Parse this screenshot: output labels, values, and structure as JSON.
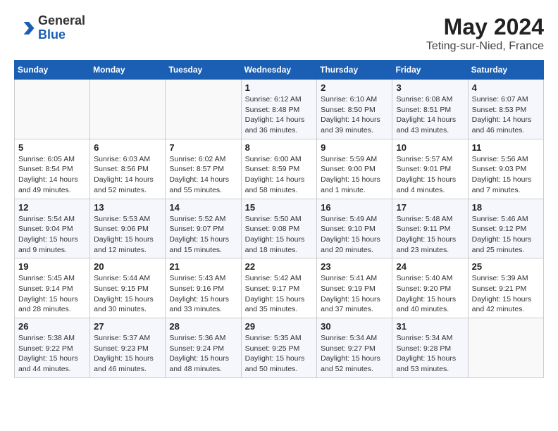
{
  "header": {
    "logo_general": "General",
    "logo_blue": "Blue",
    "month": "May 2024",
    "location": "Teting-sur-Nied, France"
  },
  "days_of_week": [
    "Sunday",
    "Monday",
    "Tuesday",
    "Wednesday",
    "Thursday",
    "Friday",
    "Saturday"
  ],
  "weeks": [
    [
      {
        "day": "",
        "info": ""
      },
      {
        "day": "",
        "info": ""
      },
      {
        "day": "",
        "info": ""
      },
      {
        "day": "1",
        "info": "Sunrise: 6:12 AM\nSunset: 8:48 PM\nDaylight: 14 hours and 36 minutes."
      },
      {
        "day": "2",
        "info": "Sunrise: 6:10 AM\nSunset: 8:50 PM\nDaylight: 14 hours and 39 minutes."
      },
      {
        "day": "3",
        "info": "Sunrise: 6:08 AM\nSunset: 8:51 PM\nDaylight: 14 hours and 43 minutes."
      },
      {
        "day": "4",
        "info": "Sunrise: 6:07 AM\nSunset: 8:53 PM\nDaylight: 14 hours and 46 minutes."
      }
    ],
    [
      {
        "day": "5",
        "info": "Sunrise: 6:05 AM\nSunset: 8:54 PM\nDaylight: 14 hours and 49 minutes."
      },
      {
        "day": "6",
        "info": "Sunrise: 6:03 AM\nSunset: 8:56 PM\nDaylight: 14 hours and 52 minutes."
      },
      {
        "day": "7",
        "info": "Sunrise: 6:02 AM\nSunset: 8:57 PM\nDaylight: 14 hours and 55 minutes."
      },
      {
        "day": "8",
        "info": "Sunrise: 6:00 AM\nSunset: 8:59 PM\nDaylight: 14 hours and 58 minutes."
      },
      {
        "day": "9",
        "info": "Sunrise: 5:59 AM\nSunset: 9:00 PM\nDaylight: 15 hours and 1 minute."
      },
      {
        "day": "10",
        "info": "Sunrise: 5:57 AM\nSunset: 9:01 PM\nDaylight: 15 hours and 4 minutes."
      },
      {
        "day": "11",
        "info": "Sunrise: 5:56 AM\nSunset: 9:03 PM\nDaylight: 15 hours and 7 minutes."
      }
    ],
    [
      {
        "day": "12",
        "info": "Sunrise: 5:54 AM\nSunset: 9:04 PM\nDaylight: 15 hours and 9 minutes."
      },
      {
        "day": "13",
        "info": "Sunrise: 5:53 AM\nSunset: 9:06 PM\nDaylight: 15 hours and 12 minutes."
      },
      {
        "day": "14",
        "info": "Sunrise: 5:52 AM\nSunset: 9:07 PM\nDaylight: 15 hours and 15 minutes."
      },
      {
        "day": "15",
        "info": "Sunrise: 5:50 AM\nSunset: 9:08 PM\nDaylight: 15 hours and 18 minutes."
      },
      {
        "day": "16",
        "info": "Sunrise: 5:49 AM\nSunset: 9:10 PM\nDaylight: 15 hours and 20 minutes."
      },
      {
        "day": "17",
        "info": "Sunrise: 5:48 AM\nSunset: 9:11 PM\nDaylight: 15 hours and 23 minutes."
      },
      {
        "day": "18",
        "info": "Sunrise: 5:46 AM\nSunset: 9:12 PM\nDaylight: 15 hours and 25 minutes."
      }
    ],
    [
      {
        "day": "19",
        "info": "Sunrise: 5:45 AM\nSunset: 9:14 PM\nDaylight: 15 hours and 28 minutes."
      },
      {
        "day": "20",
        "info": "Sunrise: 5:44 AM\nSunset: 9:15 PM\nDaylight: 15 hours and 30 minutes."
      },
      {
        "day": "21",
        "info": "Sunrise: 5:43 AM\nSunset: 9:16 PM\nDaylight: 15 hours and 33 minutes."
      },
      {
        "day": "22",
        "info": "Sunrise: 5:42 AM\nSunset: 9:17 PM\nDaylight: 15 hours and 35 minutes."
      },
      {
        "day": "23",
        "info": "Sunrise: 5:41 AM\nSunset: 9:19 PM\nDaylight: 15 hours and 37 minutes."
      },
      {
        "day": "24",
        "info": "Sunrise: 5:40 AM\nSunset: 9:20 PM\nDaylight: 15 hours and 40 minutes."
      },
      {
        "day": "25",
        "info": "Sunrise: 5:39 AM\nSunset: 9:21 PM\nDaylight: 15 hours and 42 minutes."
      }
    ],
    [
      {
        "day": "26",
        "info": "Sunrise: 5:38 AM\nSunset: 9:22 PM\nDaylight: 15 hours and 44 minutes."
      },
      {
        "day": "27",
        "info": "Sunrise: 5:37 AM\nSunset: 9:23 PM\nDaylight: 15 hours and 46 minutes."
      },
      {
        "day": "28",
        "info": "Sunrise: 5:36 AM\nSunset: 9:24 PM\nDaylight: 15 hours and 48 minutes."
      },
      {
        "day": "29",
        "info": "Sunrise: 5:35 AM\nSunset: 9:25 PM\nDaylight: 15 hours and 50 minutes."
      },
      {
        "day": "30",
        "info": "Sunrise: 5:34 AM\nSunset: 9:27 PM\nDaylight: 15 hours and 52 minutes."
      },
      {
        "day": "31",
        "info": "Sunrise: 5:34 AM\nSunset: 9:28 PM\nDaylight: 15 hours and 53 minutes."
      },
      {
        "day": "",
        "info": ""
      }
    ]
  ]
}
